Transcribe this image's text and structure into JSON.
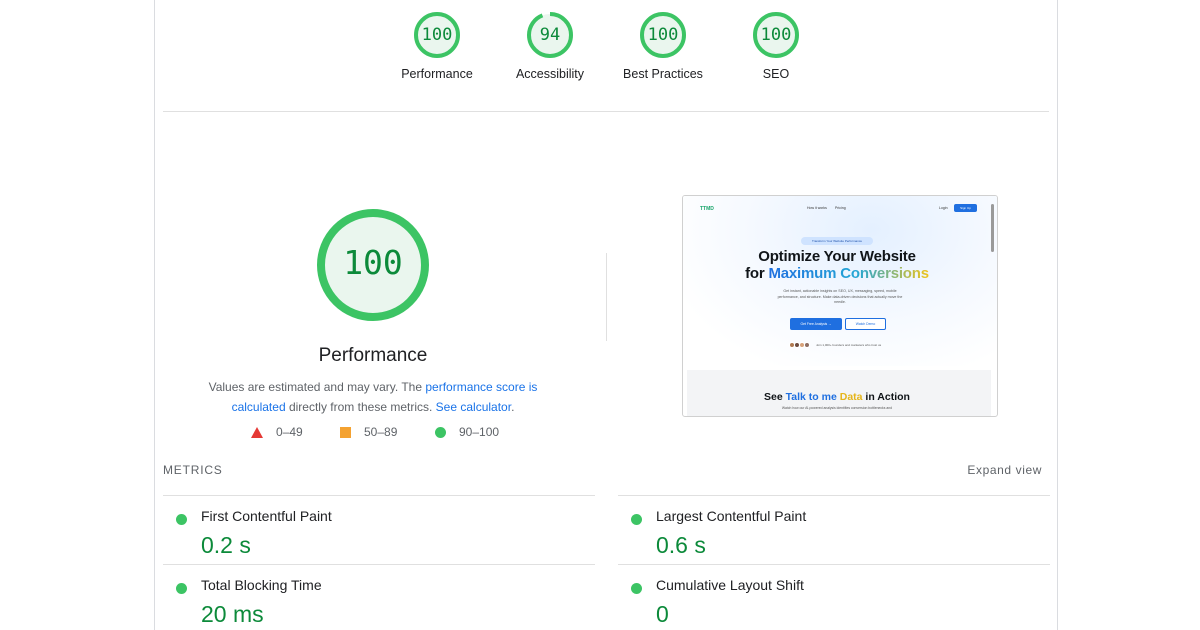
{
  "categories": [
    {
      "label": "Performance",
      "score": 100
    },
    {
      "label": "Accessibility",
      "score": 94
    },
    {
      "label": "Best Practices",
      "score": 100
    },
    {
      "label": "SEO",
      "score": 100
    }
  ],
  "performance": {
    "score": 100,
    "title": "Performance",
    "desc": {
      "part1": "Values are estimated and may vary. The ",
      "link1": "performance score is calculated",
      "part2": " directly from these metrics. ",
      "link2": "See calculator",
      "part3": "."
    }
  },
  "legend": {
    "fail": "0–49",
    "average": "50–89",
    "pass": "90–100"
  },
  "colors": {
    "pass": "#0c8a3a",
    "pass_fill": "#3cc464",
    "pass_bg": "#e6f4ea",
    "average": "#f4a231",
    "fail": "#e53935",
    "link": "#1a73e8"
  },
  "thumbnail": {
    "logo": "TTMD",
    "nav": [
      "How it works",
      "Pricing"
    ],
    "login": "Login",
    "signup": "Sign Up",
    "pill": "Transform Your Website Performance",
    "headline1": "Optimize Your Website",
    "headline2_prefix": "for ",
    "headline2_accent": "Maximum Conversions",
    "subtext": "Get instant, actionable insights on SEO, UX, messaging, speed, mobile performance, and structure. Make data-driven decisions that actually move the needle.",
    "cta_primary": "Get Free Analysis →",
    "cta_secondary": "Watch Demo",
    "trust": "Join 1,000+ founders and marketers who trust us",
    "section_title_prefix": "See ",
    "section_title_blue": "Talk to me ",
    "section_title_yellow": "Data",
    "section_title_suffix": " in Action",
    "section_sub": "Watch how our AI-powered analysis identifies conversion bottlenecks and"
  },
  "metrics": {
    "title": "METRICS",
    "expand": "Expand view",
    "items": [
      {
        "label": "First Contentful Paint",
        "value": "0.2 s"
      },
      {
        "label": "Largest Contentful Paint",
        "value": "0.6 s"
      },
      {
        "label": "Total Blocking Time",
        "value": "20 ms"
      },
      {
        "label": "Cumulative Layout Shift",
        "value": "0"
      }
    ]
  }
}
